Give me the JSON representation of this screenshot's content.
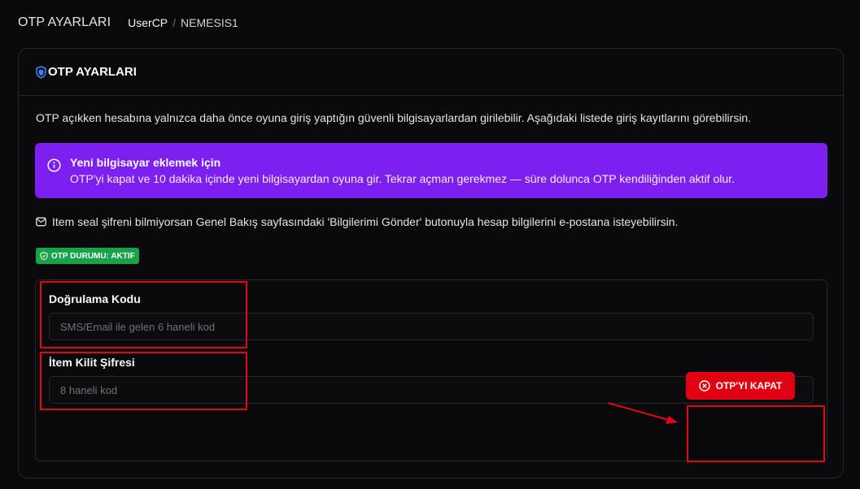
{
  "header": {
    "page_title": "OTP AYARLARI",
    "breadcrumb": [
      "UserCP",
      "NEMESIS1"
    ],
    "breadcrumb_sep": "/"
  },
  "card": {
    "title": "OTP AYARLARI",
    "description": "OTP açıkken hesabına yalnızca daha önce oyuna giriş yaptığın güvenli bilgisayarlardan girilebilir. Aşağıdaki listede giriş kayıtlarını görebilirsin.",
    "info": {
      "title": "Yeni bilgisayar eklemek için",
      "text": "OTP'yi kapat ve 10 dakika içinde yeni bilgisayardan oyuna gir. Tekrar açman gerekmez — süre dolunca OTP kendiliğinden aktif olur."
    },
    "mail_note": "Item seal şifreni bilmiyorsan Genel Bakış sayfasındaki 'Bilgilerimi Gönder' butonuyla hesap bilgilerini e-postana isteyebilirsin.",
    "status_badge": "OTP DURUMU: AKTIF"
  },
  "form": {
    "verification": {
      "label": "Doğrulama Kodu",
      "placeholder": "SMS/Email ile gelen 6 haneli kod",
      "value": ""
    },
    "item_lock": {
      "label": "İtem Kilit Şifresi",
      "placeholder": "8 haneli kod",
      "value": ""
    },
    "submit_label": "OTP'YI KAPAT"
  },
  "icons": {
    "header": "shield-icon",
    "info": "info-circle-icon",
    "mail": "mail-icon",
    "badge": "shield-check-icon",
    "button": "x-circle-icon"
  },
  "colors": {
    "background": "#09090b",
    "accent_purple": "#7c1ff0",
    "status_green": "#16a34a",
    "danger_red": "#e10012",
    "annotation_red": "#e30613"
  }
}
